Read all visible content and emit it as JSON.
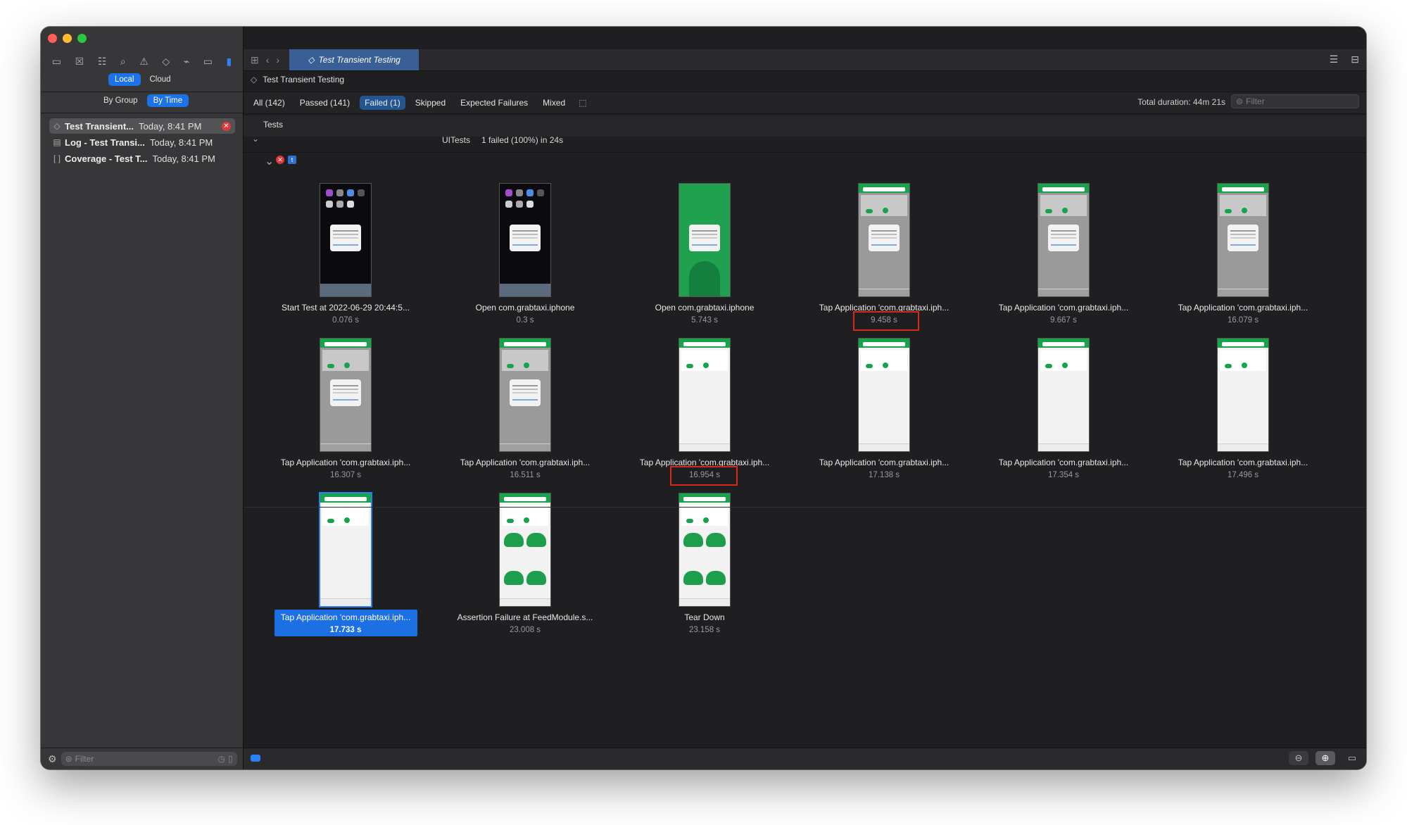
{
  "window": {
    "traffic_colors": [
      "#ff5f57",
      "#febc2e",
      "#28c840"
    ]
  },
  "sidebar": {
    "nav_icons": [
      "folder-icon",
      "source-control-icon",
      "symbol-icon",
      "find-icon",
      "issue-icon",
      "test-icon",
      "debug-icon",
      "breakpoint-icon",
      "report-icon"
    ],
    "scope": {
      "local": "Local",
      "cloud": "Cloud"
    },
    "grouping": {
      "by_group": "By Group",
      "by_time": "By Time"
    },
    "reports": [
      {
        "name": "Test Transient...",
        "time": "Today, 8:41 PM",
        "icon": "test-diamond-icon",
        "failed": true
      },
      {
        "name": "Log - Test Transi...",
        "time": "Today, 8:41 PM",
        "icon": "log-icon",
        "failed": false
      },
      {
        "name": "Coverage - Test T...",
        "time": "Today, 8:41 PM",
        "icon": "coverage-icon",
        "failed": false
      }
    ],
    "filter_placeholder": "Filter"
  },
  "editor": {
    "tab_title": "Test Transient Testing",
    "breadcrumb": "Test Transient Testing",
    "filters": {
      "all": "All (142)",
      "passed": "Passed (141)",
      "failed": "Failed (1)",
      "skipped": "Skipped",
      "expected": "Expected Failures",
      "mixed": "Mixed"
    },
    "total_duration": "Total duration: 44m 21s",
    "filter_placeholder": "Filter",
    "tests_header": "Tests",
    "suite_name": "UITests",
    "suite_status": "1 failed (100%) in 24s",
    "failed_badge": "t"
  },
  "attachments": [
    {
      "label": "Start Test at 2022-06-29 20:44:5...",
      "duration": "0.076 s",
      "screen": "home"
    },
    {
      "label": "Open com.grabtaxi.iphone",
      "duration": "0.3 s",
      "screen": "home"
    },
    {
      "label": "Open com.grabtaxi.iphone",
      "duration": "5.743 s",
      "screen": "splash"
    },
    {
      "label": "Tap Application 'com.grabtaxi.iph...",
      "duration": "9.458 s",
      "screen": "app-alert",
      "highlight": true
    },
    {
      "label": "Tap Application 'com.grabtaxi.iph...",
      "duration": "9.667 s",
      "screen": "app-alert"
    },
    {
      "label": "Tap Application 'com.grabtaxi.iph...",
      "duration": "16.079 s",
      "screen": "app-alert"
    },
    {
      "label": "Tap Application 'com.grabtaxi.iph...",
      "duration": "16.307 s",
      "screen": "app-alert"
    },
    {
      "label": "Tap Application 'com.grabtaxi.iph...",
      "duration": "16.511 s",
      "screen": "app-alert"
    },
    {
      "label": "Tap Application 'com.grabtaxi.iph...",
      "duration": "16.954 s",
      "screen": "app",
      "highlight": true
    },
    {
      "label": "Tap Application 'com.grabtaxi.iph...",
      "duration": "17.138 s",
      "screen": "app"
    },
    {
      "label": "Tap Application 'com.grabtaxi.iph...",
      "duration": "17.354 s",
      "screen": "app"
    },
    {
      "label": "Tap Application 'com.grabtaxi.iph...",
      "duration": "17.496 s",
      "screen": "app"
    },
    {
      "label": "Tap Application 'com.grabtaxi.iph...",
      "duration": "17.733 s",
      "screen": "app",
      "selected": true
    },
    {
      "label": "Assertion Failure at FeedModule.s...",
      "duration": "23.008 s",
      "screen": "app-cars"
    },
    {
      "label": "Tear Down",
      "duration": "23.158 s",
      "screen": "app-cars"
    }
  ],
  "colors": {
    "accent": "#1e72e8",
    "fail_red": "#e0383b",
    "highlight_red": "#d72a1f",
    "grab_green": "#16a34a"
  }
}
